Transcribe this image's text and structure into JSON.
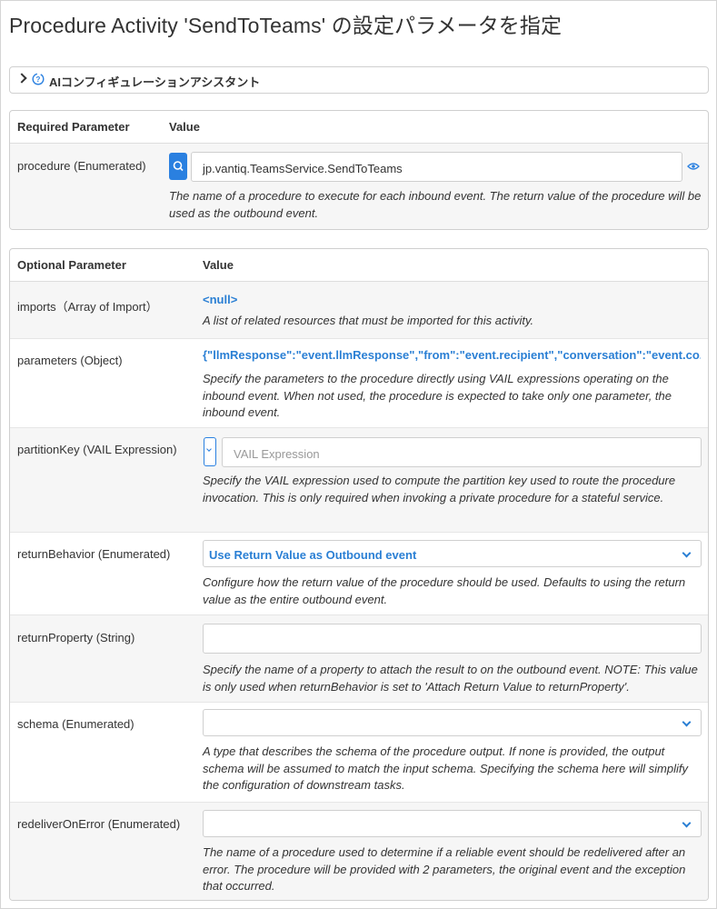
{
  "page_title": "Procedure Activity 'SendToTeams' の設定パラメータを指定",
  "ai_assistant": {
    "label": "AIコンフィギュレーションアシスタント",
    "icon": "ai-assistant-icon"
  },
  "colors": {
    "accent": "#2a80e0",
    "link": "#2a7fd4",
    "text": "#333333"
  },
  "required": {
    "header_param": "Required Parameter",
    "header_value": "Value",
    "procedure": {
      "name": "procedure (Enumerated)",
      "value": "jp.vantiq.TeamsService.SendToTeams",
      "description": "The name of a procedure to execute for each inbound event. The return value of the procedure will be used as the outbound event."
    }
  },
  "optional": {
    "header_param": "Optional Parameter",
    "header_value": "Value",
    "imports": {
      "name": "imports（Array of Import）",
      "value": "<null>",
      "description": "A list of related resources that must be imported for this activity."
    },
    "parameters": {
      "name": "parameters (Object)",
      "value": "{\"llmResponse\":\"event.llmResponse\",\"from\":\"event.recipient\",\"conversation\":\"event.co...",
      "description": "Specify the parameters to the procedure directly using VAIL expressions operating on the inbound event. When not used, the procedure is expected to take only one parameter, the inbound event."
    },
    "partitionKey": {
      "name": "partitionKey (VAIL Expression)",
      "placeholder": "VAIL Expression",
      "description": "Specify the VAIL expression used to compute the partition key used to route the procedure invocation. This is only required when invoking a private procedure for a stateful service."
    },
    "returnBehavior": {
      "name": "returnBehavior (Enumerated)",
      "value": "Use Return Value as Outbound event",
      "description": "Configure how the return value of the procedure should be used. Defaults to using the return value as the entire outbound event."
    },
    "returnProperty": {
      "name": "returnProperty (String)",
      "value": "",
      "description": "Specify the name of a property to attach the result to on the outbound event. NOTE: This value is only used when returnBehavior is set to 'Attach Return Value to returnProperty'."
    },
    "schema": {
      "name": "schema (Enumerated)",
      "value": "",
      "description": "A type that describes the schema of the procedure output. If none is provided, the output schema will be assumed to match the input schema. Specifying the schema here will simplify the configuration of downstream tasks."
    },
    "redeliverOnError": {
      "name": "redeliverOnError (Enumerated)",
      "value": "",
      "description": "The name of a procedure used to determine if a reliable event should be redelivered after an error. The procedure will be provided with 2 parameters, the original event and the exception that occurred."
    }
  }
}
